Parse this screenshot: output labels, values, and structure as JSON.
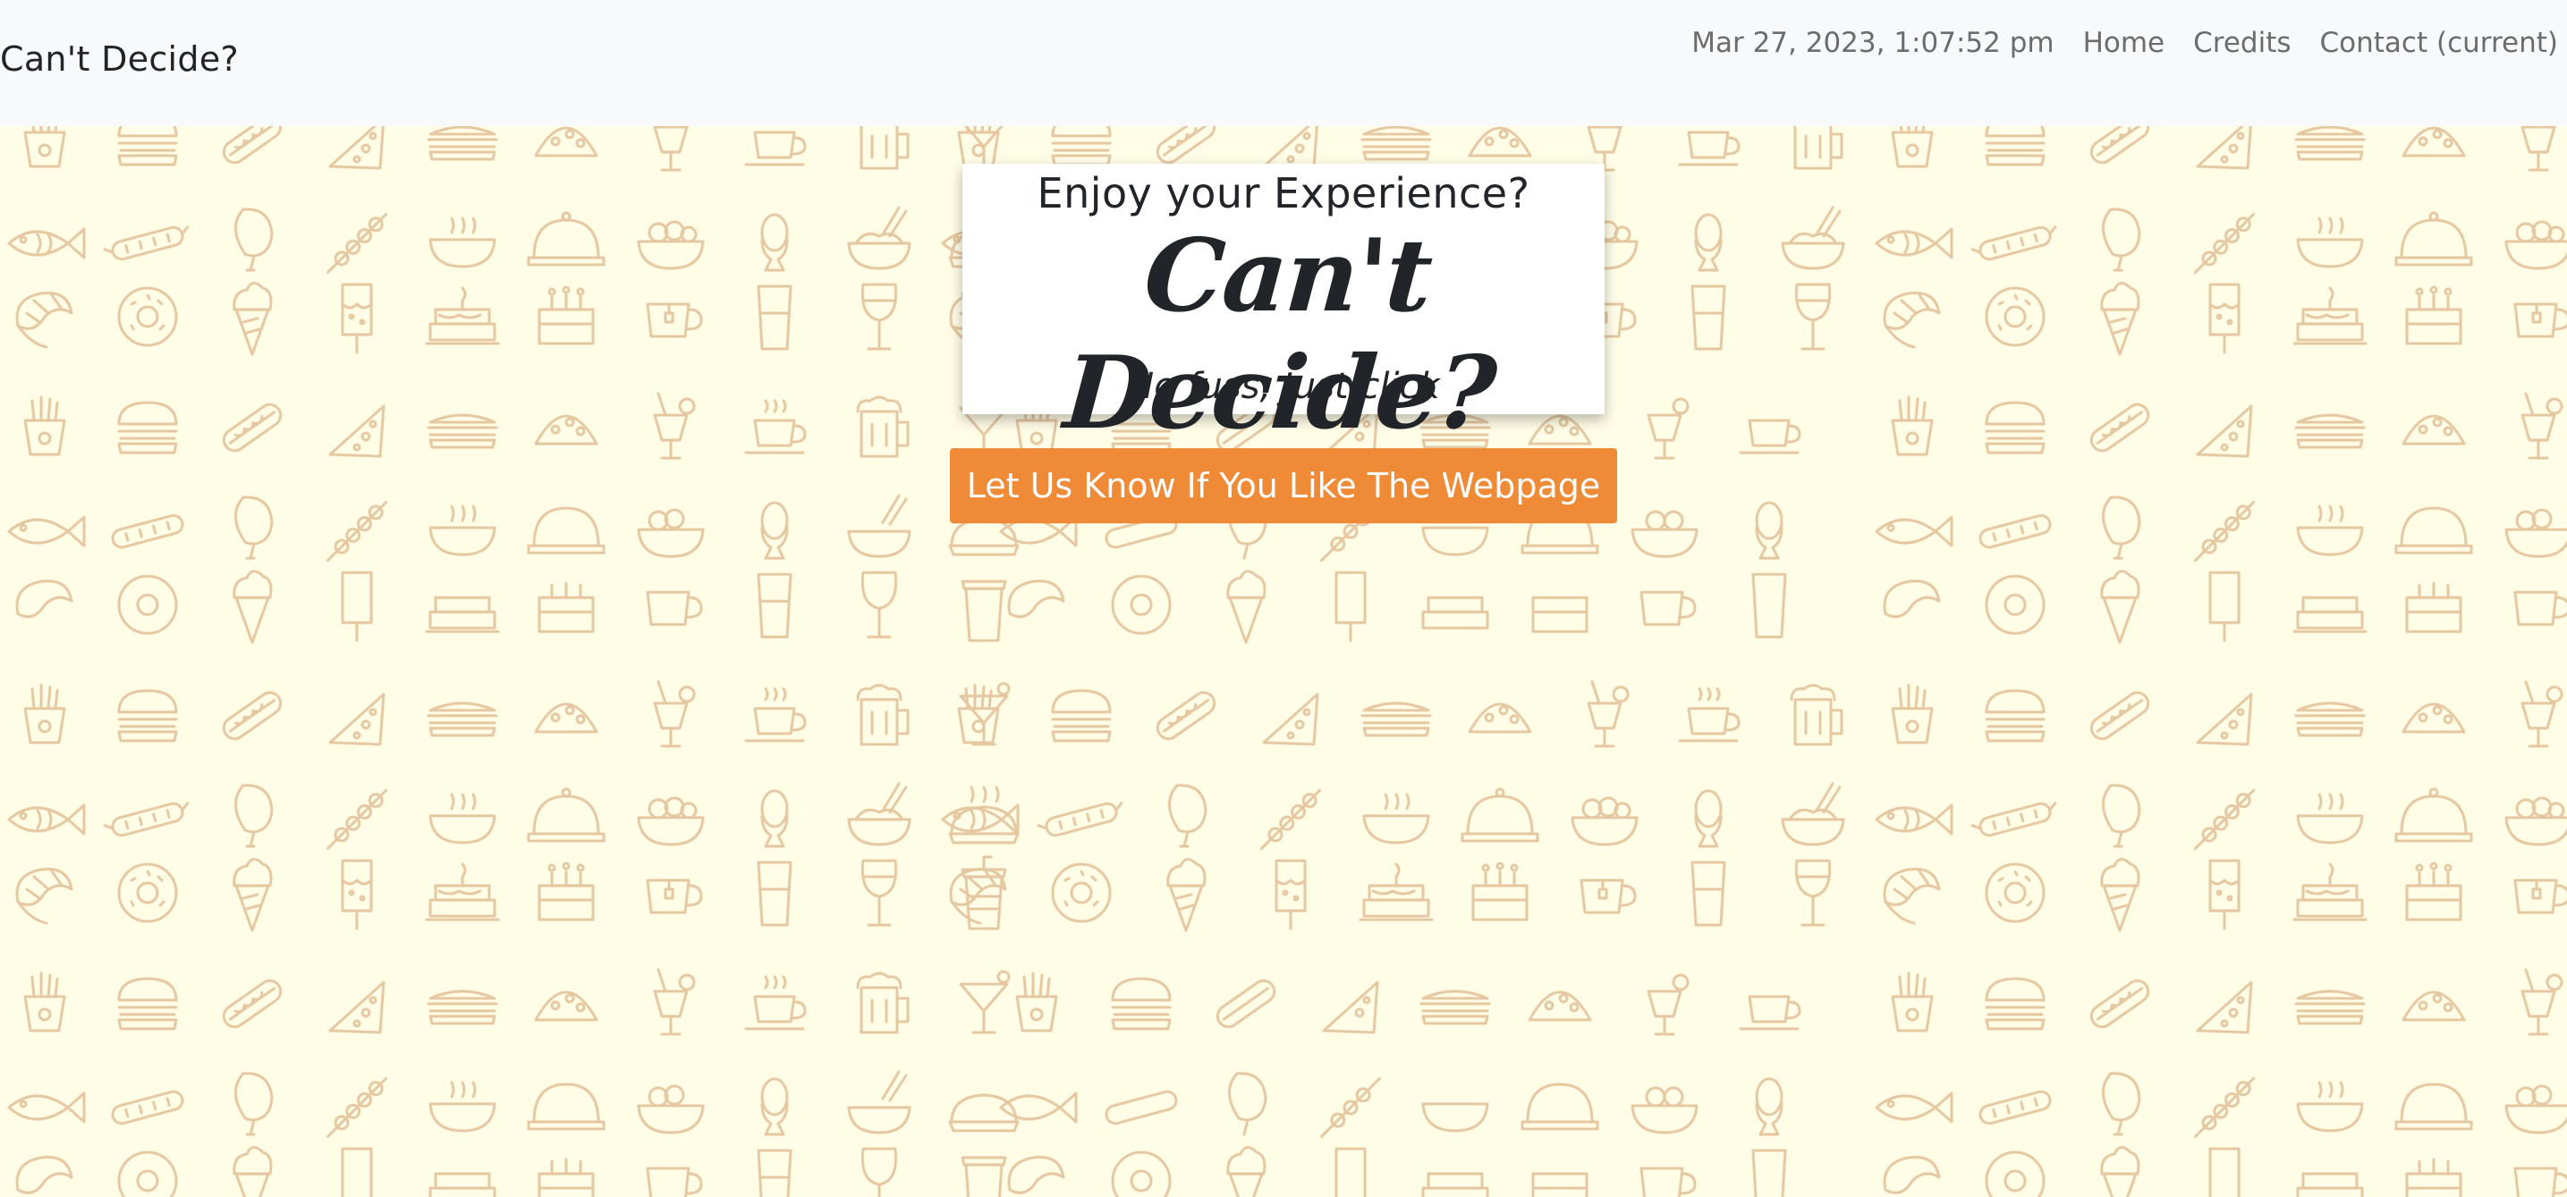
{
  "navbar": {
    "brand": "Can't Decide?",
    "datetime": "Mar 27, 2023, 1:07:52 pm",
    "links": [
      {
        "label": "Home"
      },
      {
        "label": "Credits"
      },
      {
        "label": "Contact (current)"
      }
    ]
  },
  "hero": {
    "lead": "Enjoy your Experience?",
    "headline": "Can't Decide?",
    "tagline": "No fuss, Just click",
    "cta_label": "Let Us Know If You Like The Webpage"
  },
  "background": {
    "pattern": "food-doodle-pattern",
    "icons": [
      "fries-icon",
      "burger-icon",
      "hotdog-icon",
      "pizza-slice-icon",
      "sandwich-icon",
      "taco-icon",
      "cocktail-icon",
      "coffee-cup-icon",
      "beer-mug-icon",
      "martini-icon",
      "fish-icon",
      "sausage-icon",
      "drumstick-icon",
      "skewer-icon",
      "soup-bowl-icon",
      "cloche-icon",
      "noodle-bowl-icon",
      "egg-cup-icon",
      "rice-bowl-icon",
      "pie-icon",
      "croissant-icon",
      "donut-icon",
      "ice-cream-cone-icon",
      "popsicle-icon",
      "pancakes-icon",
      "birthday-cake-icon",
      "tea-cup-icon",
      "glass-icon",
      "wine-glass-icon",
      "takeaway-cup-icon"
    ]
  },
  "colors": {
    "background": "#fffde6",
    "navbar": "#f8f9fa",
    "pattern_stroke": "#e0bf96",
    "cta": "#ef8a36"
  }
}
